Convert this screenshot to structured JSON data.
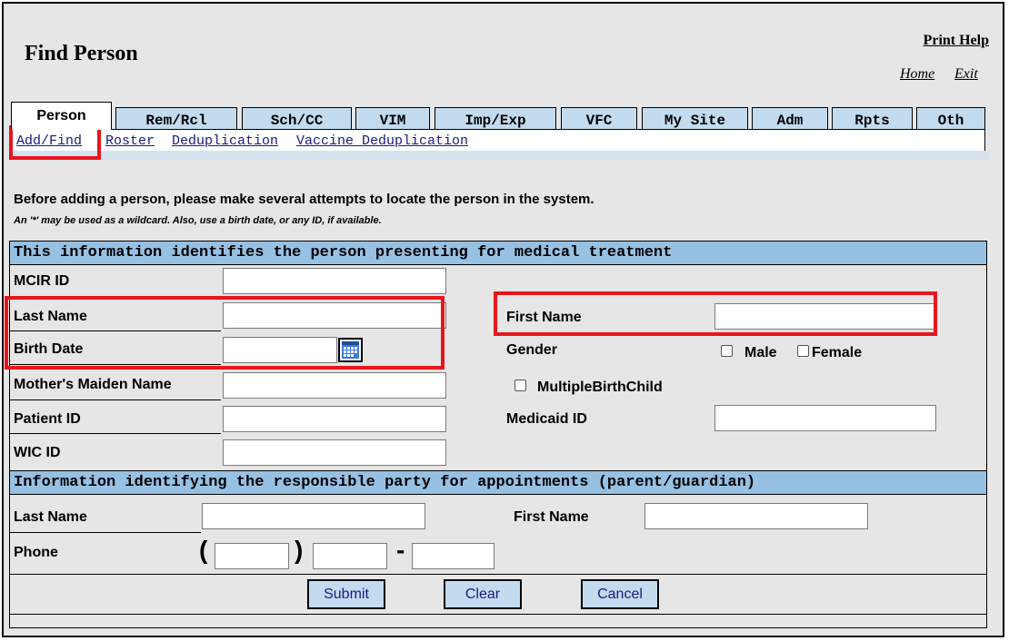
{
  "header": {
    "title": "Find Person",
    "print_help": "Print Help",
    "home": "Home",
    "exit": "Exit"
  },
  "tabs": [
    {
      "label": "Person",
      "active": true
    },
    {
      "label": "Rem/Rcl"
    },
    {
      "label": "Sch/CC"
    },
    {
      "label": "VIM"
    },
    {
      "label": "Imp/Exp"
    },
    {
      "label": "VFC"
    },
    {
      "label": "My Site"
    },
    {
      "label": "Adm"
    },
    {
      "label": "Rpts"
    },
    {
      "label": "Oth"
    }
  ],
  "subnav": [
    "Add/Find",
    "Roster",
    "Deduplication",
    "Vaccine Deduplication"
  ],
  "notes": {
    "line1": "Before adding a person, please make several attempts to locate the person in the system.",
    "line2": "An '*' may be used as a wildcard. Also, use a birth date, or any ID, if available."
  },
  "section1": {
    "heading": "This information identifies the person presenting for medical treatment",
    "mcir_id": "MCIR ID",
    "last_name": "Last Name",
    "birth_date": "Birth Date",
    "mothers_maiden_name": "Mother's Maiden Name",
    "patient_id": "Patient ID",
    "wic_id": "WIC ID",
    "first_name": "First Name",
    "gender": "Gender",
    "male": "Male",
    "female": "Female",
    "multiple_birth": "MultipleBirthChild",
    "medicaid_id": "Medicaid ID"
  },
  "section2": {
    "heading": "Information identifying the responsible party for appointments (parent/guardian)",
    "last_name": "Last Name",
    "first_name": "First Name",
    "phone": "Phone",
    "open_paren": "(",
    "close_paren": ")",
    "dash": "-"
  },
  "buttons": {
    "submit": "Submit",
    "clear": "Clear",
    "cancel": "Cancel"
  },
  "colors": {
    "tab_bg": "#c2dbef",
    "section_header": "#97c1e3",
    "highlight": "#e8161c",
    "page_bg": "#e6e6e6"
  }
}
